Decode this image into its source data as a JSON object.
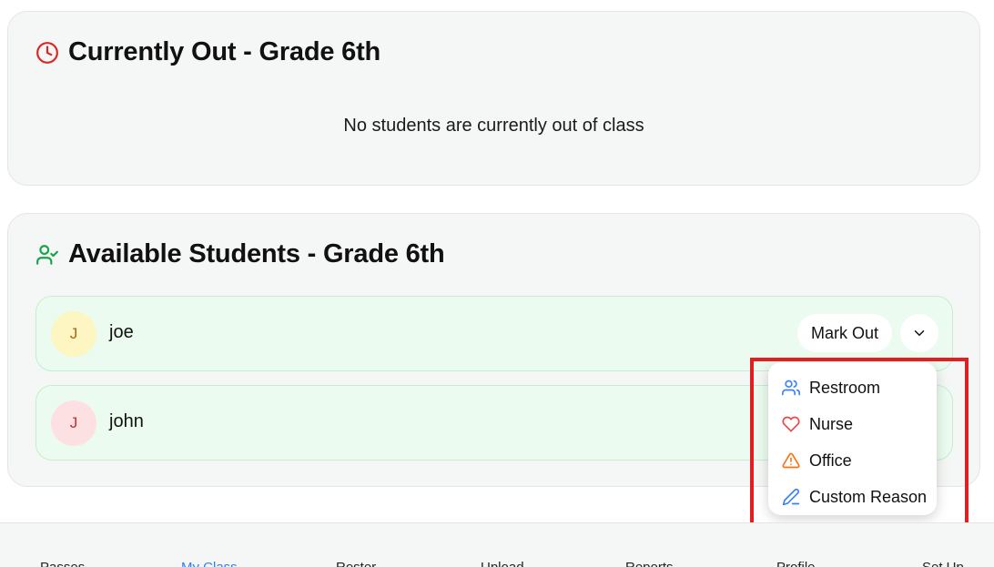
{
  "currently_out": {
    "title": "Currently Out - Grade 6th",
    "empty_message": "No students are currently out of class",
    "icon": "clock-icon"
  },
  "available": {
    "title": "Available Students - Grade 6th",
    "icon": "user-check-icon",
    "students": [
      {
        "initial": "J",
        "name": "joe",
        "mark_out_label": "Mark Out"
      },
      {
        "initial": "J",
        "name": "john"
      }
    ]
  },
  "dropdown": {
    "items": [
      {
        "label": "Restroom",
        "icon": "users-icon",
        "color": "#3b82f6"
      },
      {
        "label": "Nurse",
        "icon": "heart-icon",
        "color": "#ef4444"
      },
      {
        "label": "Office",
        "icon": "warning-icon",
        "color": "#f97316"
      },
      {
        "label": "Custom Reason",
        "icon": "pen-icon",
        "color": "#3b82f6"
      }
    ]
  },
  "nav": {
    "items": [
      {
        "label": "Passes"
      },
      {
        "label": "My Class",
        "active": true
      },
      {
        "label": "Roster"
      },
      {
        "label": "Upload"
      },
      {
        "label": "Reports"
      },
      {
        "label": "Profile"
      },
      {
        "label": "Set Up"
      }
    ]
  },
  "colors": {
    "accent": "#2f80ed",
    "highlight": "#e01f23",
    "row_bg": "#ecfbef"
  }
}
